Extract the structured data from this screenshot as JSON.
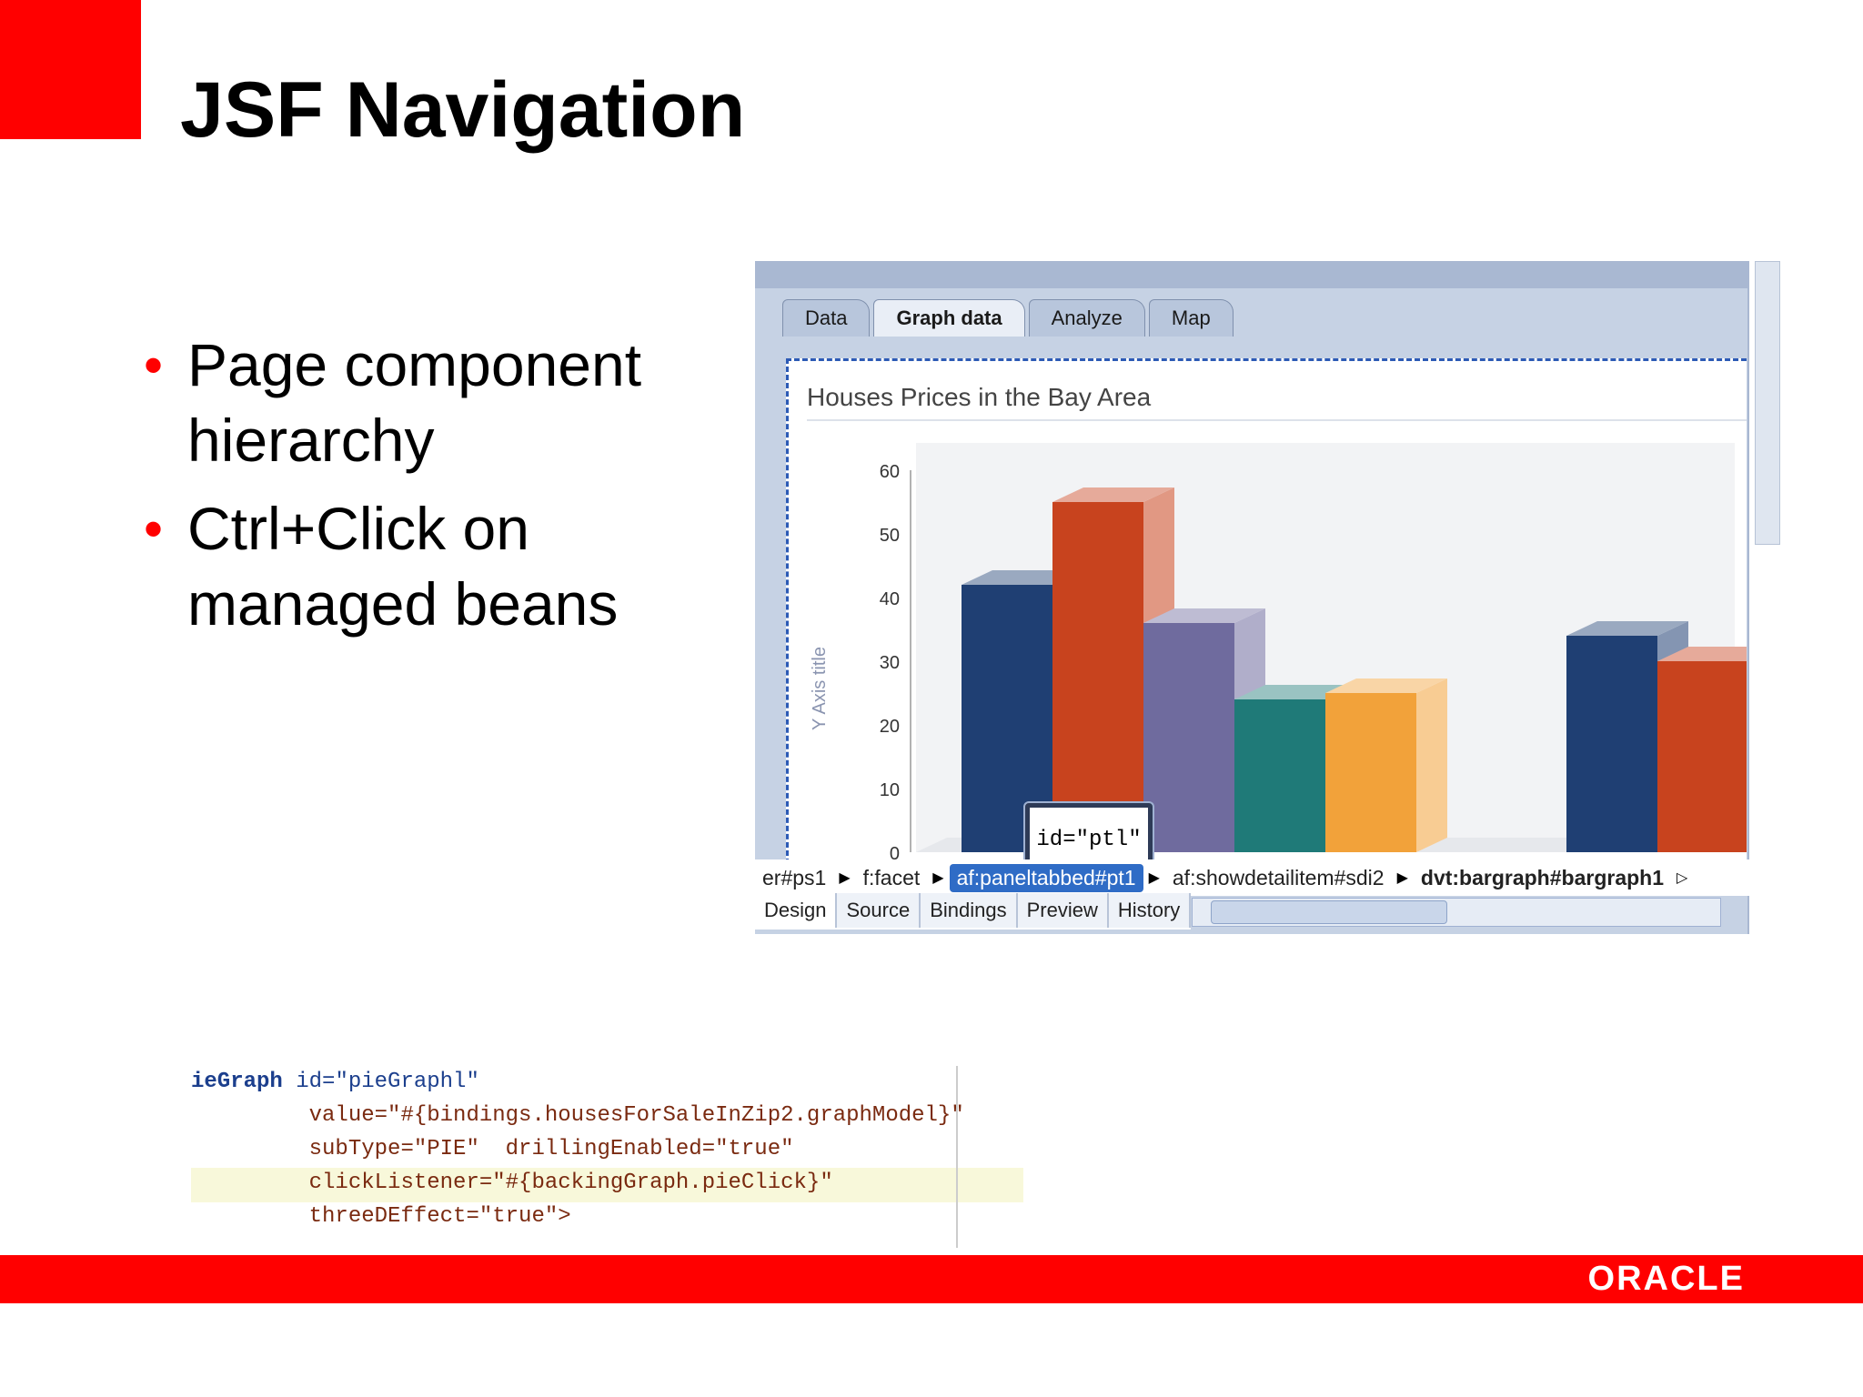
{
  "slide": {
    "title": "JSF Navigation",
    "bullets": [
      "Page component hierarchy",
      "Ctrl+Click on managed beans"
    ]
  },
  "ide": {
    "tabs": [
      "Data",
      "Graph data",
      "Analyze",
      "Map"
    ],
    "active_tab": "Graph data",
    "bottom_tabs": [
      "Design",
      "Source",
      "Bindings",
      "Preview",
      "History"
    ],
    "active_bottom_tab": "Design",
    "breadcrumb": [
      "er#ps1",
      "f:facet",
      "af:paneltabbed#pt1",
      "af:showdetailitem#sdi2",
      "dvt:bargraph#bargraph1"
    ],
    "callout_text": "id=\"ptl\""
  },
  "chart_data": {
    "type": "bar",
    "title": "Houses Prices in the Bay Area",
    "ylabel": "Y Axis title",
    "ylim": [
      0,
      60
    ],
    "yticks": [
      "0",
      "10",
      "20",
      "30",
      "40",
      "50",
      "60"
    ],
    "groups": [
      {
        "values": [
          42,
          55,
          36,
          24,
          25
        ]
      },
      {
        "values": [
          34,
          30
        ]
      }
    ],
    "colors": [
      "#1f3f73",
      "#c8431e",
      "#6f6b9e",
      "#1f7a78",
      "#f2a23a"
    ]
  },
  "code": {
    "lines": [
      {
        "tag": "ieGraph",
        "rest": " id=\"pieGraphl\""
      },
      {
        "tag": "",
        "rest": "         value=\"#{bindings.housesForSaleInZip2.graphModel}\""
      },
      {
        "tag": "",
        "rest": "         subType=\"PIE\"  drillingEnabled=\"true\""
      },
      {
        "tag": "",
        "rest": "         clickListener=\"#{backingGraph.pieClick}\""
      },
      {
        "tag": "",
        "rest": "         threeDEffect=\"true\">"
      }
    ]
  },
  "footer": {
    "logo": "ORACLE"
  }
}
